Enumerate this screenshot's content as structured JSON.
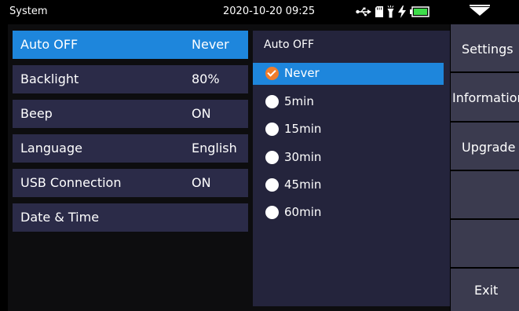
{
  "window": {
    "title": "System",
    "datetime": "2020-10-20 09:25"
  },
  "status_icons": [
    "usb-icon",
    "sd-card-icon",
    "flashlight-icon",
    "charging-icon",
    "battery-icon"
  ],
  "settings": [
    {
      "label": "Auto OFF",
      "value": "Never",
      "selected": true
    },
    {
      "label": "Backlight",
      "value": "80%"
    },
    {
      "label": "Beep",
      "value": "ON"
    },
    {
      "label": "Language",
      "value": "English"
    },
    {
      "label": "USB Connection",
      "value": "ON"
    },
    {
      "label": "Date & Time",
      "value": ""
    }
  ],
  "auto_off_panel": {
    "title": "Auto OFF",
    "options": [
      "Never",
      "5min",
      "15min",
      "30min",
      "45min",
      "60min"
    ],
    "selected_index": 0
  },
  "side_menu": {
    "settings": "Settings",
    "information": "Information",
    "upgrade": "Upgrade",
    "exit": "Exit"
  },
  "colors": {
    "accent": "#1e86dc",
    "row_background": "#2b2b48",
    "panel_background": "#24243c",
    "side_button": "#3b3b4f",
    "check_orange": "#f07d2b",
    "battery_green": "#3ddc4a"
  }
}
